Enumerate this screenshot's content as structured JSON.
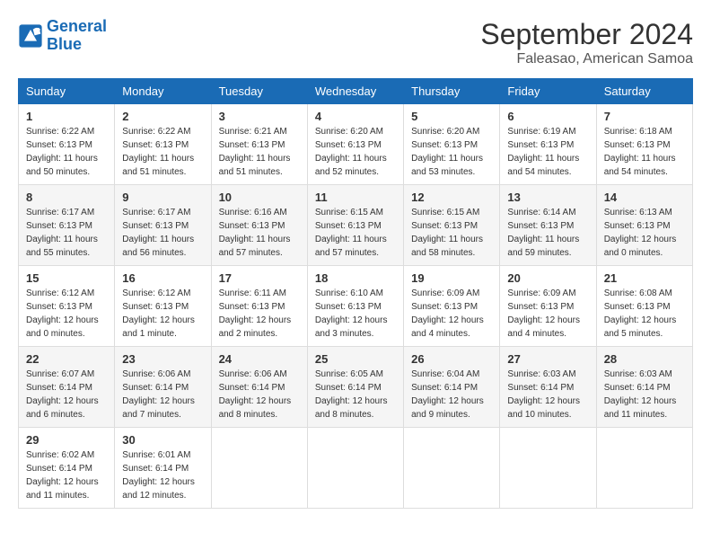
{
  "logo": {
    "line1": "General",
    "line2": "Blue"
  },
  "title": "September 2024",
  "location": "Faleasao, American Samoa",
  "weekdays": [
    "Sunday",
    "Monday",
    "Tuesday",
    "Wednesday",
    "Thursday",
    "Friday",
    "Saturday"
  ],
  "weeks": [
    [
      {
        "day": "1",
        "sunrise": "6:22 AM",
        "sunset": "6:13 PM",
        "daylight": "11 hours and 50 minutes."
      },
      {
        "day": "2",
        "sunrise": "6:22 AM",
        "sunset": "6:13 PM",
        "daylight": "11 hours and 51 minutes."
      },
      {
        "day": "3",
        "sunrise": "6:21 AM",
        "sunset": "6:13 PM",
        "daylight": "11 hours and 51 minutes."
      },
      {
        "day": "4",
        "sunrise": "6:20 AM",
        "sunset": "6:13 PM",
        "daylight": "11 hours and 52 minutes."
      },
      {
        "day": "5",
        "sunrise": "6:20 AM",
        "sunset": "6:13 PM",
        "daylight": "11 hours and 53 minutes."
      },
      {
        "day": "6",
        "sunrise": "6:19 AM",
        "sunset": "6:13 PM",
        "daylight": "11 hours and 54 minutes."
      },
      {
        "day": "7",
        "sunrise": "6:18 AM",
        "sunset": "6:13 PM",
        "daylight": "11 hours and 54 minutes."
      }
    ],
    [
      {
        "day": "8",
        "sunrise": "6:17 AM",
        "sunset": "6:13 PM",
        "daylight": "11 hours and 55 minutes."
      },
      {
        "day": "9",
        "sunrise": "6:17 AM",
        "sunset": "6:13 PM",
        "daylight": "11 hours and 56 minutes."
      },
      {
        "day": "10",
        "sunrise": "6:16 AM",
        "sunset": "6:13 PM",
        "daylight": "11 hours and 57 minutes."
      },
      {
        "day": "11",
        "sunrise": "6:15 AM",
        "sunset": "6:13 PM",
        "daylight": "11 hours and 57 minutes."
      },
      {
        "day": "12",
        "sunrise": "6:15 AM",
        "sunset": "6:13 PM",
        "daylight": "11 hours and 58 minutes."
      },
      {
        "day": "13",
        "sunrise": "6:14 AM",
        "sunset": "6:13 PM",
        "daylight": "11 hours and 59 minutes."
      },
      {
        "day": "14",
        "sunrise": "6:13 AM",
        "sunset": "6:13 PM",
        "daylight": "12 hours and 0 minutes."
      }
    ],
    [
      {
        "day": "15",
        "sunrise": "6:12 AM",
        "sunset": "6:13 PM",
        "daylight": "12 hours and 0 minutes."
      },
      {
        "day": "16",
        "sunrise": "6:12 AM",
        "sunset": "6:13 PM",
        "daylight": "12 hours and 1 minute."
      },
      {
        "day": "17",
        "sunrise": "6:11 AM",
        "sunset": "6:13 PM",
        "daylight": "12 hours and 2 minutes."
      },
      {
        "day": "18",
        "sunrise": "6:10 AM",
        "sunset": "6:13 PM",
        "daylight": "12 hours and 3 minutes."
      },
      {
        "day": "19",
        "sunrise": "6:09 AM",
        "sunset": "6:13 PM",
        "daylight": "12 hours and 4 minutes."
      },
      {
        "day": "20",
        "sunrise": "6:09 AM",
        "sunset": "6:13 PM",
        "daylight": "12 hours and 4 minutes."
      },
      {
        "day": "21",
        "sunrise": "6:08 AM",
        "sunset": "6:13 PM",
        "daylight": "12 hours and 5 minutes."
      }
    ],
    [
      {
        "day": "22",
        "sunrise": "6:07 AM",
        "sunset": "6:14 PM",
        "daylight": "12 hours and 6 minutes."
      },
      {
        "day": "23",
        "sunrise": "6:06 AM",
        "sunset": "6:14 PM",
        "daylight": "12 hours and 7 minutes."
      },
      {
        "day": "24",
        "sunrise": "6:06 AM",
        "sunset": "6:14 PM",
        "daylight": "12 hours and 8 minutes."
      },
      {
        "day": "25",
        "sunrise": "6:05 AM",
        "sunset": "6:14 PM",
        "daylight": "12 hours and 8 minutes."
      },
      {
        "day": "26",
        "sunrise": "6:04 AM",
        "sunset": "6:14 PM",
        "daylight": "12 hours and 9 minutes."
      },
      {
        "day": "27",
        "sunrise": "6:03 AM",
        "sunset": "6:14 PM",
        "daylight": "12 hours and 10 minutes."
      },
      {
        "day": "28",
        "sunrise": "6:03 AM",
        "sunset": "6:14 PM",
        "daylight": "12 hours and 11 minutes."
      }
    ],
    [
      {
        "day": "29",
        "sunrise": "6:02 AM",
        "sunset": "6:14 PM",
        "daylight": "12 hours and 11 minutes."
      },
      {
        "day": "30",
        "sunrise": "6:01 AM",
        "sunset": "6:14 PM",
        "daylight": "12 hours and 12 minutes."
      },
      null,
      null,
      null,
      null,
      null
    ]
  ]
}
